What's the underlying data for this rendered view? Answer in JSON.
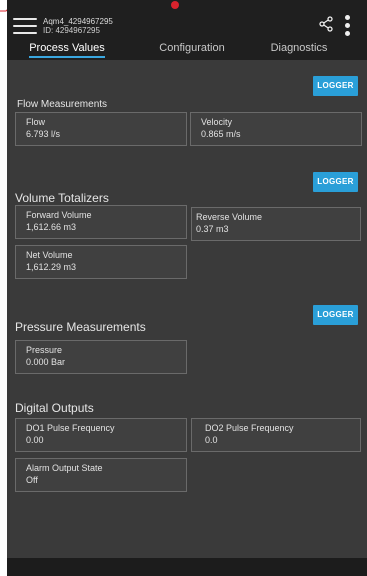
{
  "header": {
    "device_name": "Aqm4_4294967295",
    "device_id": "ID: 4294967295"
  },
  "tabs": [
    {
      "label": "Process Values",
      "active": true
    },
    {
      "label": "Configuration",
      "active": false
    },
    {
      "label": "Diagnostics",
      "active": false
    }
  ],
  "logger_label": "LOGGER",
  "flow": {
    "title": "Flow Measurements",
    "flow_label": "Flow",
    "flow_value": "6.793 l/s",
    "velocity_label": "Velocity",
    "velocity_value": "0.865 m/s"
  },
  "volume": {
    "title": "Volume Totalizers",
    "forward_label": "Forward Volume",
    "forward_value": "1,612.66  m3",
    "reverse_label": "Reverse Volume",
    "reverse_value": "0.37   m3",
    "net_label": "Net Volume",
    "net_value": "1,612.29  m3"
  },
  "pressure": {
    "title": "Pressure Measurements",
    "pressure_label": "Pressure",
    "pressure_value": "0.000  Bar"
  },
  "digital": {
    "title": "Digital Outputs",
    "do1_label": "DO1 Pulse Frequency",
    "do1_value": "0.00",
    "do2_label": "DO2 Pulse Frequency",
    "do2_value": "0.0",
    "alarm_label": "Alarm Output State",
    "alarm_value": "Off"
  },
  "colors": {
    "accent": "#2a9fd8",
    "background": "#3a3a3a",
    "topbar": "#1f1f1f"
  }
}
